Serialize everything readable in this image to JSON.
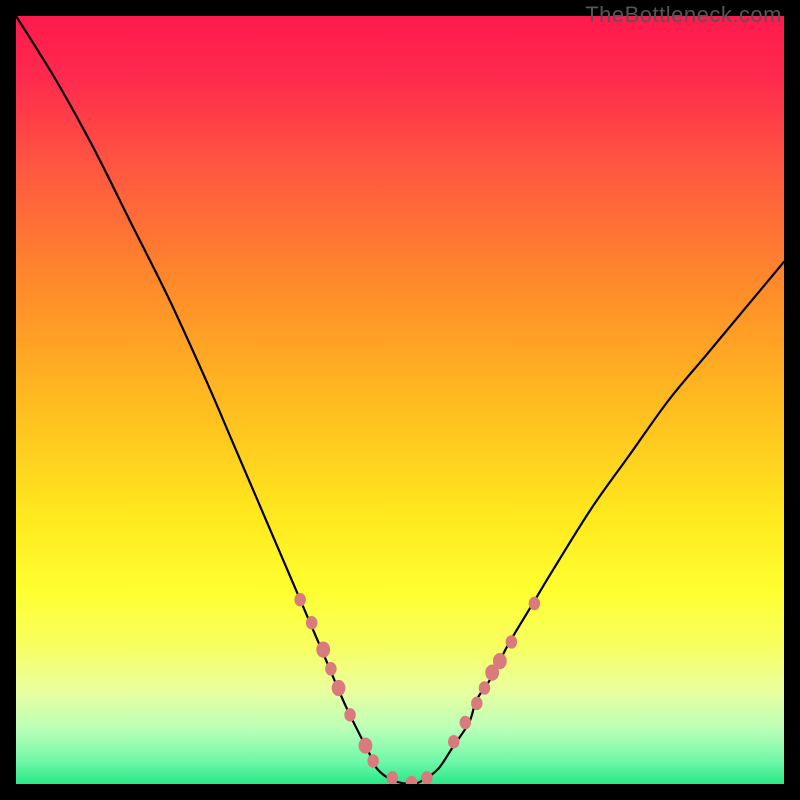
{
  "watermark": "TheBottleneck.com",
  "chart_data": {
    "type": "line",
    "title": "",
    "xlabel": "",
    "ylabel": "",
    "xlim": [
      0,
      100
    ],
    "ylim": [
      0,
      100
    ],
    "series": [
      {
        "name": "bottleneck-curve",
        "x": [
          0,
          5,
          10,
          15,
          20,
          25,
          28,
          31,
          34,
          37,
          40,
          43,
          46,
          47,
          49,
          51.5,
          53,
          55,
          57,
          59,
          60,
          62,
          64,
          67,
          70,
          75,
          80,
          85,
          90,
          95,
          100
        ],
        "y": [
          100,
          92,
          83,
          73,
          63,
          52,
          45,
          38,
          31,
          24,
          17,
          10,
          4,
          2,
          0.5,
          0,
          0.5,
          2,
          5,
          8,
          11,
          14,
          18,
          23,
          28,
          36,
          43,
          50,
          56,
          62,
          68
        ]
      }
    ],
    "markers": {
      "name": "highlight-dots",
      "color": "#d97b7c",
      "points": [
        {
          "x": 37,
          "y": 24,
          "r": 5
        },
        {
          "x": 38.5,
          "y": 21,
          "r": 5
        },
        {
          "x": 40,
          "y": 17.5,
          "r": 6
        },
        {
          "x": 41,
          "y": 15,
          "r": 5
        },
        {
          "x": 42,
          "y": 12.5,
          "r": 6
        },
        {
          "x": 43.5,
          "y": 9,
          "r": 5
        },
        {
          "x": 45.5,
          "y": 5,
          "r": 6
        },
        {
          "x": 46.5,
          "y": 3,
          "r": 5
        },
        {
          "x": 49,
          "y": 0.8,
          "r": 5
        },
        {
          "x": 51.5,
          "y": 0.2,
          "r": 5
        },
        {
          "x": 53.5,
          "y": 0.8,
          "r": 5
        },
        {
          "x": 57,
          "y": 5.5,
          "r": 5
        },
        {
          "x": 58.5,
          "y": 8,
          "r": 5
        },
        {
          "x": 60,
          "y": 10.5,
          "r": 5
        },
        {
          "x": 61,
          "y": 12.5,
          "r": 5
        },
        {
          "x": 62,
          "y": 14.5,
          "r": 6
        },
        {
          "x": 63,
          "y": 16,
          "r": 6
        },
        {
          "x": 64.5,
          "y": 18.5,
          "r": 5
        },
        {
          "x": 67.5,
          "y": 23.5,
          "r": 5
        }
      ]
    },
    "gradient_stops": [
      {
        "offset": 0.0,
        "color": "#ff1a4d"
      },
      {
        "offset": 0.08,
        "color": "#ff2a4d"
      },
      {
        "offset": 0.2,
        "color": "#ff5840"
      },
      {
        "offset": 0.35,
        "color": "#ff8a2a"
      },
      {
        "offset": 0.5,
        "color": "#ffba20"
      },
      {
        "offset": 0.65,
        "color": "#ffe81e"
      },
      {
        "offset": 0.75,
        "color": "#ffff30"
      },
      {
        "offset": 0.82,
        "color": "#f7ff60"
      },
      {
        "offset": 0.88,
        "color": "#e8ffa0"
      },
      {
        "offset": 0.93,
        "color": "#b8ffb8"
      },
      {
        "offset": 0.97,
        "color": "#70f8a8"
      },
      {
        "offset": 1.0,
        "color": "#28e888"
      }
    ],
    "bottom_band": {
      "from": 0.78,
      "color_top": "#ffffa0",
      "color_bottom": "#28e888"
    }
  }
}
